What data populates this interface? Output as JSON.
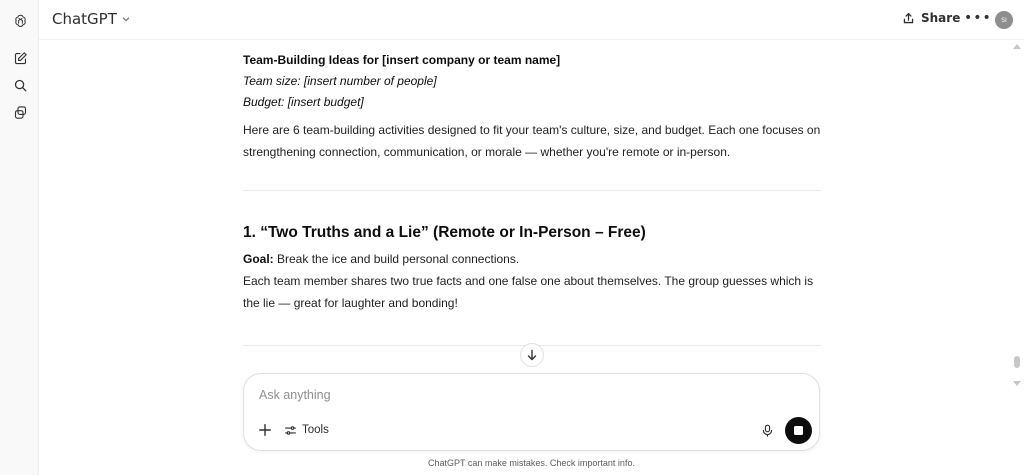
{
  "app": {
    "title": "ChatGPT",
    "avatar_initials": "SI"
  },
  "header": {
    "share_label": "Share",
    "more_label": "•••"
  },
  "message": {
    "heading": "Team-Building Ideas for [insert company or team name]",
    "team_size": "Team size: [insert number of people]",
    "budget": "Budget: [insert budget]",
    "intro_line1": "Here are 6 team-building activities designed to fit your team's culture, size, and budget. Each one focuses on",
    "intro_line2": "strengthening connection, communication, or morale — whether you're remote or in-person.",
    "section1": {
      "title": "1. “Two Truths and a Lie” (Remote or In-Person – Free)",
      "goal_label": "Goal:",
      "goal_text": " Break the ice and build personal connections.",
      "body_line1": "Each team member shares two true facts and one false one about themselves. The group guesses which is",
      "body_line2": "the lie — great for laughter and bonding!"
    }
  },
  "composer": {
    "placeholder": "Ask anything",
    "tools_label": "Tools"
  },
  "footer": {
    "disclaimer": "ChatGPT can make mistakes. Check important info."
  },
  "icons": {
    "logo": "openai-logo-icon",
    "new_chat": "new-chat-icon",
    "search": "search-icon",
    "library": "library-icon",
    "share": "share-icon",
    "scroll_down": "arrow-down-icon",
    "plus": "plus-icon",
    "tools": "tools-icon",
    "mic": "microphone-icon",
    "stop": "stop-icon"
  },
  "colors": {
    "accent": "#0d0d0d",
    "avatar_bg": "#8e8e8e"
  }
}
